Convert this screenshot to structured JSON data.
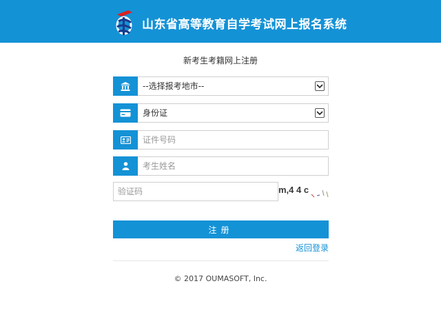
{
  "header": {
    "site_title": "山东省高等教育自学考试网上报名系统",
    "logo": "exam-logo-icon",
    "bg_color": "#1492d6"
  },
  "form": {
    "title": "新考生考籍网上注册",
    "city_select": {
      "icon": "bank-icon",
      "value": "--选择报考地市--"
    },
    "id_type_select": {
      "icon": "id-card-icon",
      "value": "身份证"
    },
    "id_number": {
      "icon": "vcard-icon",
      "placeholder": "证件号码"
    },
    "name": {
      "icon": "user-icon",
      "placeholder": "考生姓名"
    },
    "captcha": {
      "placeholder": "验证码",
      "image_text": "m,4 4 c"
    },
    "submit_label": "注册",
    "back_link": "返回登录"
  },
  "footer": {
    "copyright": "© 2017 OUMASOFT, Inc."
  }
}
